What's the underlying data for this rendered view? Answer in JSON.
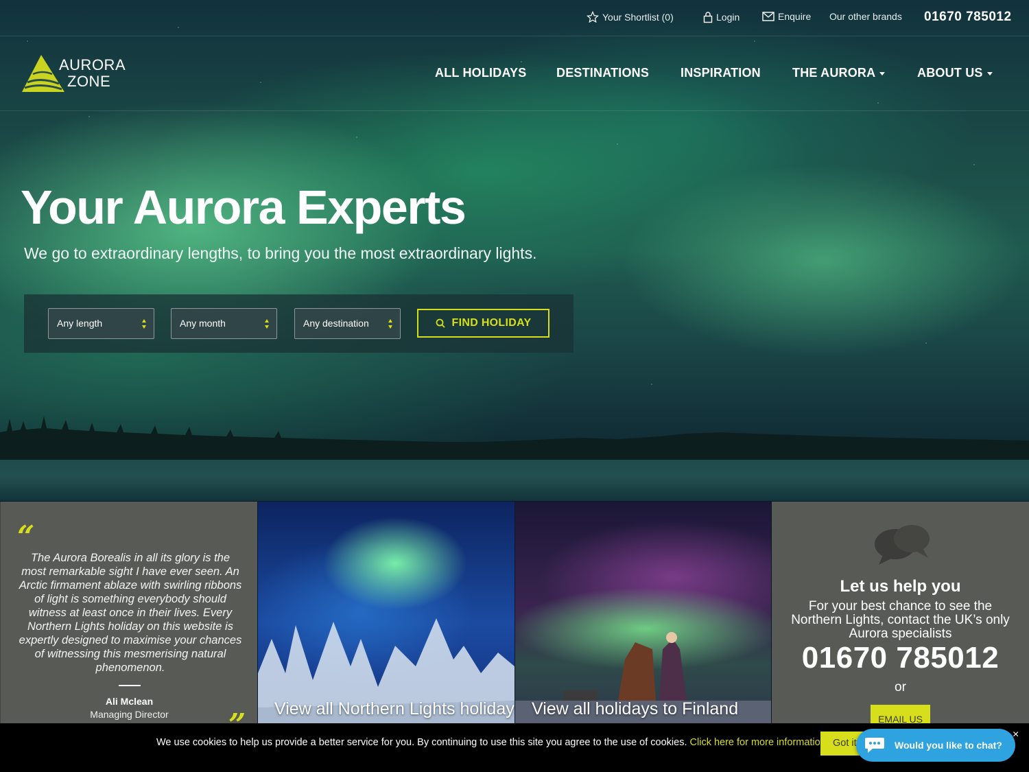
{
  "topbar": {
    "shortlist_label": "Your Shortlist (0)",
    "login_label": "Login",
    "enquire_label": "Enquire",
    "other_brands_label": "Our other brands",
    "phone": "01670 785012"
  },
  "logo": {
    "line1": "AURORA",
    "line2": "ZONE"
  },
  "nav": {
    "all_holidays": "ALL HOLIDAYS",
    "destinations": "DESTINATIONS",
    "inspiration": "INSPIRATION",
    "the_aurora": "THE AURORA",
    "about_us": "ABOUT US"
  },
  "hero": {
    "title": "Your Aurora Experts",
    "subtitle": "We go to extraordinary lengths, to bring you the most extraordinary lights."
  },
  "search": {
    "length_value": "Any length",
    "month_value": "Any month",
    "destination_value": "Any destination",
    "find_label": "FIND HOLIDAY"
  },
  "quote": {
    "open_mark": "“",
    "close_mark": "”",
    "text": "The Aurora Borealis in all its glory is the most remarkable sight I have ever seen. An Arctic firmament ablaze with swirling ribbons of light is something everybody should witness at least once in their lives. Every Northern Lights holiday on this website is expertly designed to maximise your chances of witnessing this mesmerising natural phenomenon.",
    "name": "Ali Mclean",
    "role": "Managing Director"
  },
  "tiles": {
    "northern_lights_caption": "View all Northern Lights holidays",
    "finland_caption": "View all holidays to Finland"
  },
  "help": {
    "title": "Let us help you",
    "text": "For your best chance to see the Northern Lights, contact the UK’s only Aurora specialists",
    "phone": "01670 785012",
    "or": "or",
    "email_label": "EMAIL US"
  },
  "cookie": {
    "text": "We use cookies to help us provide a better service for you. By continuing to use this site you agree to the use of cookies.",
    "link": "Click here for more information",
    "got_it": "Got it!"
  },
  "chat": {
    "label": "Would you like to chat?",
    "close": "×"
  },
  "colors": {
    "accent": "#d7de1c",
    "panel_gray": "#585a55",
    "chat_blue": "#2fa3e0"
  }
}
